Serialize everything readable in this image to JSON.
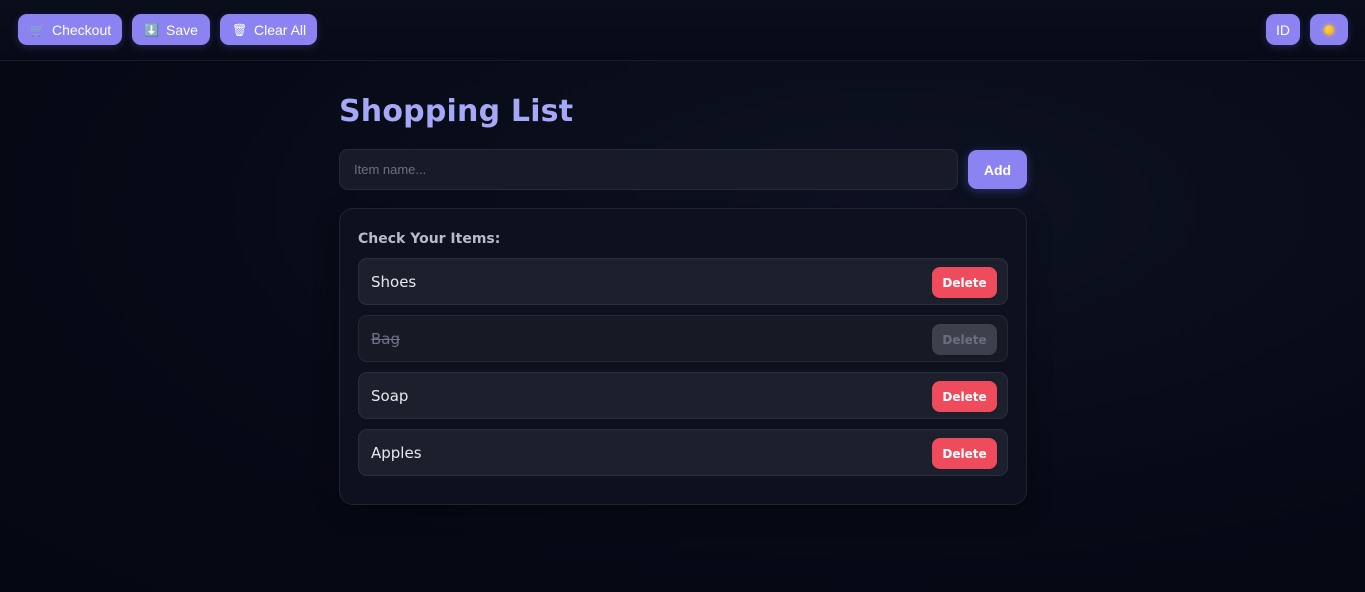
{
  "toolbar": {
    "checkout_icon": "🛒",
    "checkout_label": "Checkout",
    "save_icon": "⬇️",
    "save_label": "Save",
    "clear_icon": "🗑",
    "clear_label": "Clear All",
    "lang_label": "ID"
  },
  "main": {
    "title": "Shopping List",
    "input_placeholder": "Item name...",
    "add_label": "Add",
    "list_heading": "Check Your Items:",
    "items": [
      {
        "label": "Shoes",
        "done": false,
        "delete_label": "Delete"
      },
      {
        "label": "Bag",
        "done": true,
        "delete_label": "Delete"
      },
      {
        "label": "Soap",
        "done": false,
        "delete_label": "Delete"
      },
      {
        "label": "Apples",
        "done": false,
        "delete_label": "Delete"
      }
    ]
  },
  "colors": {
    "accent": "#8b83f2",
    "title": "#a5a8f6",
    "danger": "#ee4c5d",
    "background": "#070a16"
  }
}
